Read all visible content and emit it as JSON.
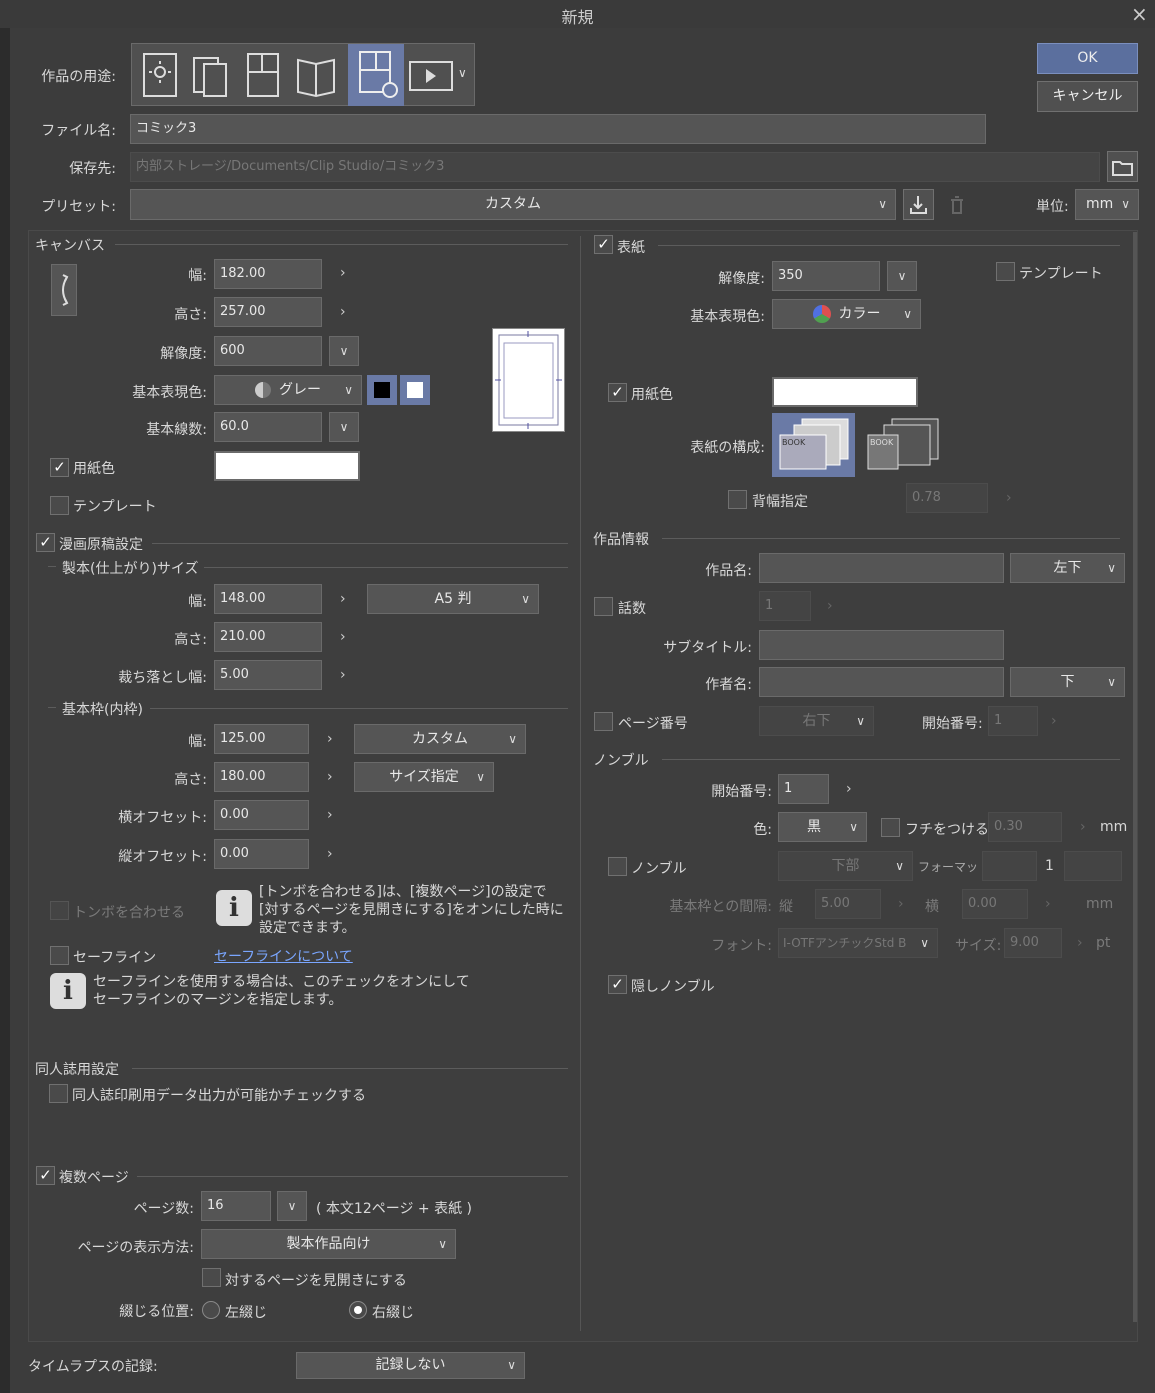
{
  "dialog": {
    "title": "新規",
    "close": "×",
    "ok": "OK",
    "cancel": "キャンセル"
  },
  "top": {
    "usage_label": "作品の用途:",
    "filename_label": "ファイル名:",
    "filename_value": "コミック3",
    "save_label": "保存先:",
    "save_path": "内部ストレージ/Documents/Clip Studio/コミック3",
    "preset_label": "プリセット:",
    "preset_value": "カスタム",
    "unit_label": "単位:",
    "unit_value": "mm"
  },
  "canvas": {
    "section": "キャンバス",
    "width_label": "幅:",
    "width": "182.00",
    "height_label": "高さ:",
    "height": "257.00",
    "res_label": "解像度:",
    "res": "600",
    "color_label": "基本表現色:",
    "color": "グレー",
    "line_label": "基本線数:",
    "line": "60.0",
    "paper_label": "用紙色",
    "template_label": "テンプレート"
  },
  "manga": {
    "section": "漫画原稿設定",
    "bind_section": "製本(仕上がり)サイズ",
    "bw_label": "幅:",
    "bw": "148.00",
    "bsize": "A5 判",
    "bh_label": "高さ:",
    "bh": "210.00",
    "bleed_label": "裁ち落とし幅:",
    "bleed": "5.00",
    "frame_section": "基本枠(内枠)",
    "fw_label": "幅:",
    "fw": "125.00",
    "fpreset": "カスタム",
    "fh_label": "高さ:",
    "fh": "180.00",
    "fmode": "サイズ指定",
    "xoff_label": "横オフセット:",
    "xoff": "0.00",
    "yoff_label": "縦オフセット:",
    "yoff": "0.00",
    "tombo_label": "トンボを合わせる",
    "tombo_info": [
      "[トンボを合わせる]は、[複数ページ]の設定で",
      "[対するページを見開きにする]をオンにした時に",
      "設定できます。"
    ],
    "safe_label": "セーフライン",
    "safe_link": "セーフラインについて",
    "safe_info": [
      "セーフラインを使用する場合は、このチェックをオンにして",
      "セーフラインのマージンを指定します。"
    ]
  },
  "doujin": {
    "section": "同人誌用設定",
    "check_label": "同人誌印刷用データ出力が可能かチェックする"
  },
  "multi": {
    "section": "複数ページ",
    "pages_label": "ページ数:",
    "pages": "16",
    "pages_note": "( 本文12ページ + 表紙 )",
    "display_label": "ページの表示方法:",
    "display": "製本作品向け",
    "spread_label": "対するページを見開きにする",
    "bind_label": "綴じる位置:",
    "left": "左綴じ",
    "right": "右綴じ"
  },
  "cover": {
    "section": "表紙",
    "res_label": "解像度:",
    "res": "350",
    "template_label": "テンプレート",
    "color_label": "基本表現色:",
    "color": "カラー",
    "paper_label": "用紙色",
    "config_label": "表紙の構成:",
    "spine_label": "背幅指定",
    "spine": "0.78",
    "book": "BOOK"
  },
  "info": {
    "section": "作品情報",
    "title_label": "作品名:",
    "title_pos": "左下",
    "ep_label": "話数",
    "ep": "1",
    "sub_label": "サブタイトル:",
    "author_label": "作者名:",
    "author_pos": "下",
    "page_label": "ページ番号",
    "page_pos": "右下",
    "start_label": "開始番号:",
    "start": "1"
  },
  "nombre": {
    "section": "ノンブル",
    "start_label": "開始番号:",
    "start": "1",
    "color_label": "色:",
    "color": "黒",
    "edge_label": "フチをつける",
    "edge": "0.30",
    "mm": "mm",
    "nb_label": "ノンブル",
    "pos": "下部",
    "format_label": "フォーマッ",
    "format": "1",
    "gap_label": "基本枠との間隔:",
    "v_label": "縦",
    "v": "5.00",
    "h_label": "横",
    "h": "0.00",
    "mm2": "mm",
    "font_label": "フォント:",
    "font": "I-OTFアンチックStd B",
    "size_label": "サイズ:",
    "size": "9.00",
    "pt": "pt",
    "hidden_label": "隠しノンブル"
  },
  "timelapse": {
    "label": "タイムラプスの記録:",
    "value": "記録しない"
  }
}
